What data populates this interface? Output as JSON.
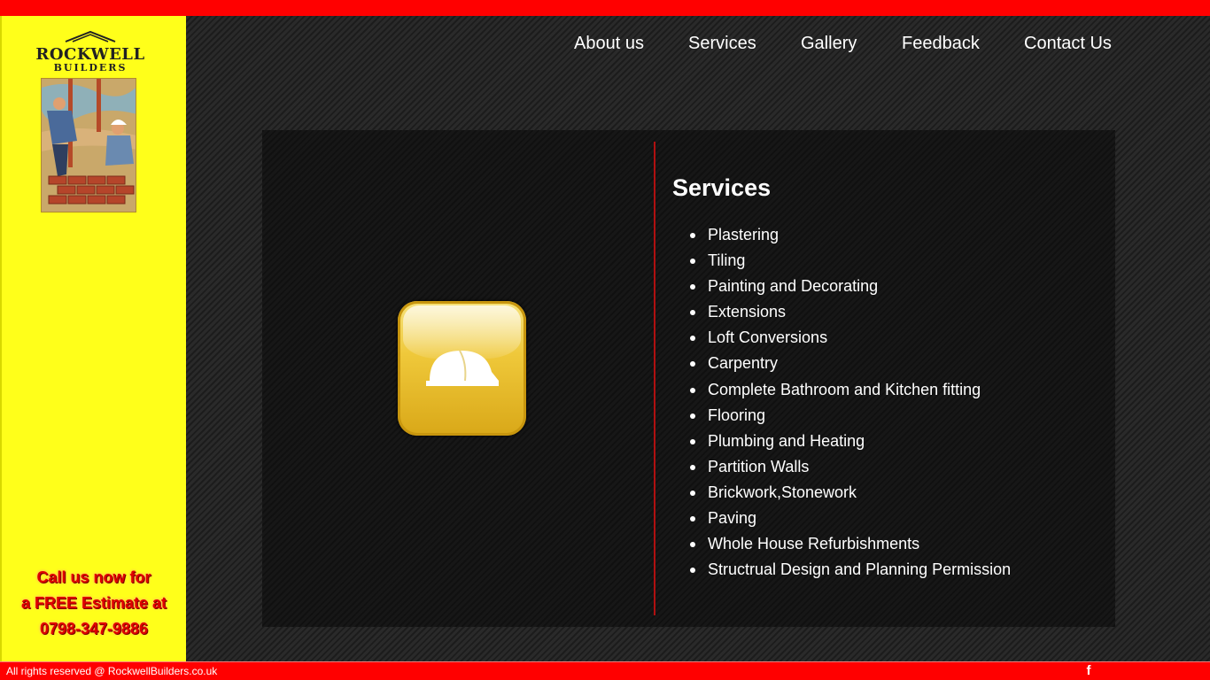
{
  "header": {
    "accent_color": "#ff0000",
    "nav": [
      {
        "label": "About us"
      },
      {
        "label": "Services"
      },
      {
        "label": "Gallery"
      },
      {
        "label": "Feedback"
      },
      {
        "label": "Contact Us"
      }
    ]
  },
  "sidebar": {
    "background_color": "#ffff1a",
    "logo": {
      "title": "ROCKWELL",
      "subtitle": "BUILDERS"
    },
    "callout": {
      "line1": "Call us now for",
      "line2": "a FREE Estimate at",
      "phone": "0798-347-9886"
    }
  },
  "main": {
    "icon": "hard-hat-icon",
    "title": "Services",
    "services": [
      "Plastering",
      "Tiling",
      "Painting and Decorating",
      "Extensions",
      "Loft Conversions",
      "Carpentry",
      "Complete Bathroom and Kitchen fitting",
      "Flooring",
      "Plumbing and Heating",
      "Partition Walls",
      "Brickwork,Stonework",
      "Paving",
      "Whole House Refurbishments",
      "Structrual Design and Planning Permission"
    ]
  },
  "footer": {
    "copyright": "All rights reserved @ RockwellBuilders.co.uk",
    "social_icon": "facebook-icon",
    "social_label": "f"
  }
}
